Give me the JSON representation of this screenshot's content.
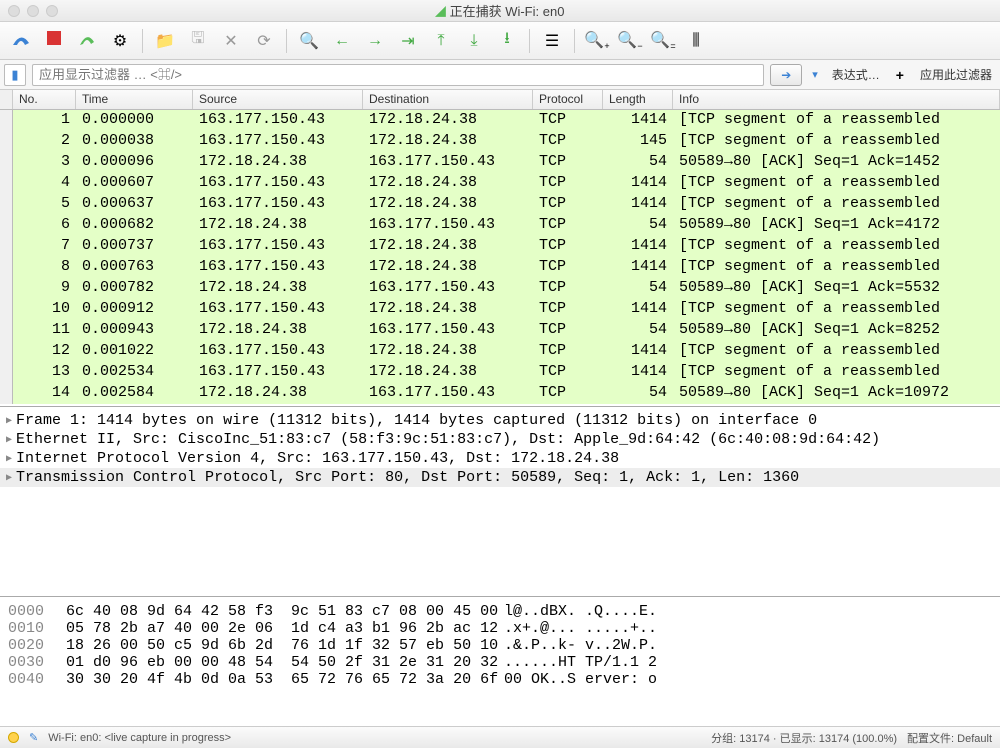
{
  "window": {
    "title": "正在捕获 Wi-Fi: en0"
  },
  "filter": {
    "placeholder": "应用显示过滤器 … <⌘/>",
    "expression_label": "表达式…",
    "apply_label": "应用此过滤器"
  },
  "columns": {
    "no": "No.",
    "time": "Time",
    "source": "Source",
    "destination": "Destination",
    "protocol": "Protocol",
    "length": "Length",
    "info": "Info"
  },
  "packets": [
    {
      "no": "1",
      "time": "0.000000",
      "src": "163.177.150.43",
      "dst": "172.18.24.38",
      "proto": "TCP",
      "len": "1414",
      "info": "[TCP segment of a reassembled"
    },
    {
      "no": "2",
      "time": "0.000038",
      "src": "163.177.150.43",
      "dst": "172.18.24.38",
      "proto": "TCP",
      "len": "145",
      "info": "[TCP segment of a reassembled"
    },
    {
      "no": "3",
      "time": "0.000096",
      "src": "172.18.24.38",
      "dst": "163.177.150.43",
      "proto": "TCP",
      "len": "54",
      "info": "50589→80 [ACK] Seq=1 Ack=1452"
    },
    {
      "no": "4",
      "time": "0.000607",
      "src": "163.177.150.43",
      "dst": "172.18.24.38",
      "proto": "TCP",
      "len": "1414",
      "info": "[TCP segment of a reassembled"
    },
    {
      "no": "5",
      "time": "0.000637",
      "src": "163.177.150.43",
      "dst": "172.18.24.38",
      "proto": "TCP",
      "len": "1414",
      "info": "[TCP segment of a reassembled"
    },
    {
      "no": "6",
      "time": "0.000682",
      "src": "172.18.24.38",
      "dst": "163.177.150.43",
      "proto": "TCP",
      "len": "54",
      "info": "50589→80 [ACK] Seq=1 Ack=4172"
    },
    {
      "no": "7",
      "time": "0.000737",
      "src": "163.177.150.43",
      "dst": "172.18.24.38",
      "proto": "TCP",
      "len": "1414",
      "info": "[TCP segment of a reassembled"
    },
    {
      "no": "8",
      "time": "0.000763",
      "src": "163.177.150.43",
      "dst": "172.18.24.38",
      "proto": "TCP",
      "len": "1414",
      "info": "[TCP segment of a reassembled"
    },
    {
      "no": "9",
      "time": "0.000782",
      "src": "172.18.24.38",
      "dst": "163.177.150.43",
      "proto": "TCP",
      "len": "54",
      "info": "50589→80 [ACK] Seq=1 Ack=5532"
    },
    {
      "no": "10",
      "time": "0.000912",
      "src": "163.177.150.43",
      "dst": "172.18.24.38",
      "proto": "TCP",
      "len": "1414",
      "info": "[TCP segment of a reassembled"
    },
    {
      "no": "11",
      "time": "0.000943",
      "src": "172.18.24.38",
      "dst": "163.177.150.43",
      "proto": "TCP",
      "len": "54",
      "info": "50589→80 [ACK] Seq=1 Ack=8252"
    },
    {
      "no": "12",
      "time": "0.001022",
      "src": "163.177.150.43",
      "dst": "172.18.24.38",
      "proto": "TCP",
      "len": "1414",
      "info": "[TCP segment of a reassembled"
    },
    {
      "no": "13",
      "time": "0.002534",
      "src": "163.177.150.43",
      "dst": "172.18.24.38",
      "proto": "TCP",
      "len": "1414",
      "info": "[TCP segment of a reassembled"
    },
    {
      "no": "14",
      "time": "0.002584",
      "src": "172.18.24.38",
      "dst": "163.177.150.43",
      "proto": "TCP",
      "len": "54",
      "info": "50589→80 [ACK] Seq=1 Ack=10972"
    }
  ],
  "details": [
    "Frame 1: 1414 bytes on wire (11312 bits), 1414 bytes captured (11312 bits) on interface 0",
    "Ethernet II, Src: CiscoInc_51:83:c7 (58:f3:9c:51:83:c7), Dst: Apple_9d:64:42 (6c:40:08:9d:64:42)",
    "Internet Protocol Version 4, Src: 163.177.150.43, Dst: 172.18.24.38",
    "Transmission Control Protocol, Src Port: 80, Dst Port: 50589, Seq: 1, Ack: 1, Len: 1360"
  ],
  "hex": [
    {
      "off": "0000",
      "b": "6c 40 08 9d 64 42 58 f3  9c 51 83 c7 08 00 45 00",
      "a": "l@..dBX. .Q....E."
    },
    {
      "off": "0010",
      "b": "05 78 2b a7 40 00 2e 06  1d c4 a3 b1 96 2b ac 12",
      "a": ".x+.@... .....+.."
    },
    {
      "off": "0020",
      "b": "18 26 00 50 c5 9d 6b 2d  76 1d 1f 32 57 eb 50 10",
      "a": ".&.P..k- v..2W.P."
    },
    {
      "off": "0030",
      "b": "01 d0 96 eb 00 00 48 54  54 50 2f 31 2e 31 20 32",
      "a": "......HT TP/1.1 2"
    },
    {
      "off": "0040",
      "b": "30 30 20 4f 4b 0d 0a 53  65 72 76 65 72 3a 20 6f",
      "a": "00 OK..S erver: o"
    }
  ],
  "status": {
    "left": "Wi-Fi: en0: <live capture in progress>",
    "right_packets": "分组: 13174 · 已显示: 13174 (100.0%)",
    "right_profile": "配置文件: Default"
  }
}
